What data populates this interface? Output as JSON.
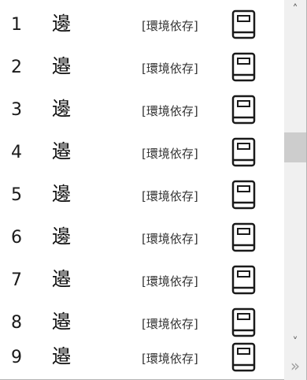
{
  "rows": [
    {
      "number": "1",
      "character": "邊",
      "tag": "[環境依存]",
      "icon": "book-icon"
    },
    {
      "number": "2",
      "character": "邉",
      "tag": "[環境依存]",
      "icon": "book-icon"
    },
    {
      "number": "3",
      "character": "邊",
      "tag": "[環境依存]",
      "icon": "book-icon"
    },
    {
      "number": "4",
      "character": "邉",
      "tag": "[環境依存]",
      "icon": "book-icon"
    },
    {
      "number": "5",
      "character": "邊",
      "tag": "[環境依存]",
      "icon": "book-icon"
    },
    {
      "number": "6",
      "character": "邊",
      "tag": "[環境依存]",
      "icon": "book-icon"
    },
    {
      "number": "7",
      "character": "邉",
      "tag": "[環境依存]",
      "icon": "book-icon"
    },
    {
      "number": "8",
      "character": "邉",
      "tag": "[環境依存]",
      "icon": "book-icon"
    },
    {
      "number": "9",
      "character": "邉",
      "tag": "[環境依存]",
      "icon": "book-icon"
    }
  ],
  "scrollbar": {
    "up_arrow": "˄",
    "down_arrow": "˅",
    "more_glyph": "»",
    "position_fraction": 0.36
  }
}
